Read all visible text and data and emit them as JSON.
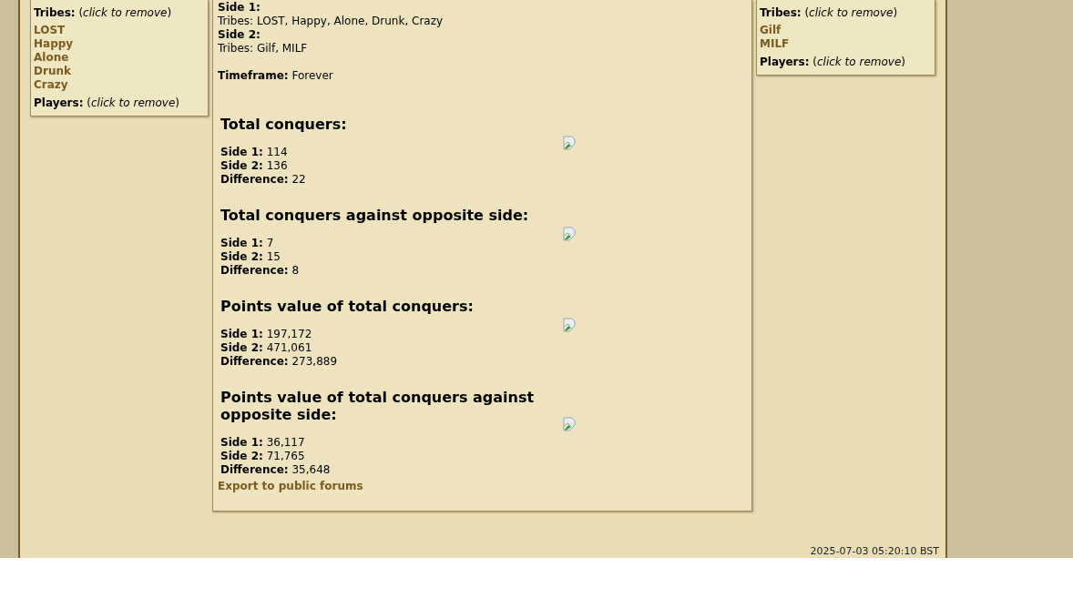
{
  "left_panel": {
    "tribes_heading": "**Tribes:** (*click to remove*)",
    "tribes": [
      "LOST",
      "Happy",
      "Alone",
      "Drunk",
      "Crazy"
    ],
    "players_heading": "**Players:** (*click to remove*)"
  },
  "summary": {
    "sides": [
      {
        "label": "Side 1:",
        "tribes": "Tribes: LOST, Happy, Alone, Drunk, Crazy"
      },
      {
        "label": "Side 2:",
        "tribes": "Tribes: Gilf, MILF"
      }
    ],
    "timeframe": {
      "label": "Timeframe:",
      "value": "Forever"
    }
  },
  "stats": [
    {
      "title": "Total conquers:",
      "rows": [
        {
          "label": "Side 1:",
          "value": "114"
        },
        {
          "label": "Side 2:",
          "value": "136"
        },
        {
          "label": "Difference:",
          "value": "22"
        }
      ]
    },
    {
      "title": "Total conquers against opposite side:",
      "rows": [
        {
          "label": "Side 1:",
          "value": "7"
        },
        {
          "label": "Side 2:",
          "value": "15"
        },
        {
          "label": "Difference:",
          "value": "8"
        }
      ]
    },
    {
      "title": "Points value of total conquers:",
      "rows": [
        {
          "label": "Side 1:",
          "value": "197,172"
        },
        {
          "label": "Side 2:",
          "value": "471,061"
        },
        {
          "label": "Difference:",
          "value": "273,889"
        }
      ]
    },
    {
      "title": "Points value of total conquers against opposite side:",
      "rows": [
        {
          "label": "Side 1:",
          "value": "36,117"
        },
        {
          "label": "Side 2:",
          "value": "71,765"
        },
        {
          "label": "Difference:",
          "value": "35,648"
        }
      ]
    }
  ],
  "export_link": "Export to public forums",
  "right_panel": {
    "tribes_heading": "**Tribes:** (*click to remove*)",
    "tribes": [
      "Gilf",
      "MILF"
    ],
    "players_heading": "**Players:** (*click to remove*)"
  },
  "timestamp": "2025-07-03 05:20:10 BST"
}
